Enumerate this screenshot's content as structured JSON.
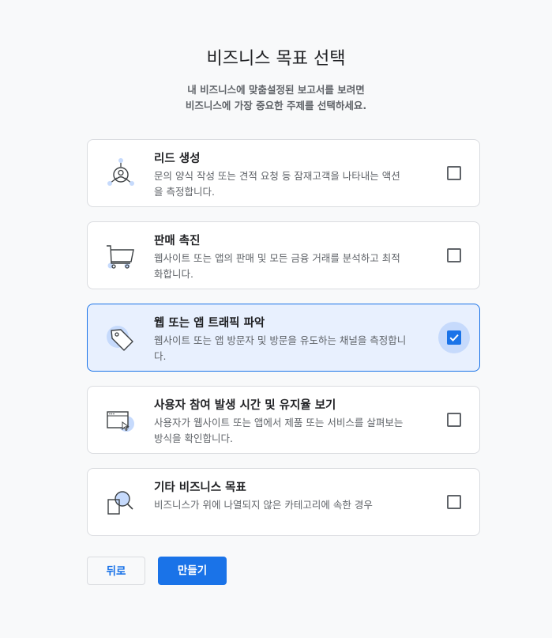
{
  "page": {
    "title": "비즈니스 목표 선택",
    "subtitle_line1": "내 비즈니스에 맞춤설정된 보고서를 보려면",
    "subtitle_line2": "비즈니스에 가장 중요한 주제를 선택하세요."
  },
  "options": [
    {
      "title": "리드 생성",
      "desc1": "문의 양식 작성 또는 견적 요청 등 잠재고객을 나타내는 액션",
      "desc2": "을 측정합니다.",
      "icon": "lead-icon",
      "checked": false
    },
    {
      "title": "판매 촉진",
      "desc1": "웹사이트 또는 앱의 판매 및 모든 금융 거래를 분석하고 최적",
      "desc2": "화합니다.",
      "icon": "shopping-cart-icon",
      "checked": false
    },
    {
      "title": "웹 또는 앱 트래픽 파악",
      "desc1": "웹사이트 또는 앱 방문자 및 방문을 유도하는 채널을 측정합니",
      "desc2": "다.",
      "icon": "tag-icon",
      "checked": true
    },
    {
      "title": "사용자 참여 발생 시간 및 유지율 보기",
      "desc1": "사용자가 웹사이트 또는 앱에서 제품 또는 서비스를 살펴보는",
      "desc2": "방식을 확인합니다.",
      "icon": "browser-window-icon",
      "checked": false
    },
    {
      "title": "기타 비즈니스 목표",
      "desc1": "비즈니스가 위에 나열되지 않은 카테고리에 속한 경우",
      "desc2": "",
      "icon": "magnifier-icon",
      "checked": false
    }
  ],
  "buttons": {
    "back": "뒤로",
    "create": "만들기"
  },
  "colors": {
    "accent": "#1a73e8",
    "selected_bg": "#e8f0fe",
    "icon_accent": "#c6dafc"
  }
}
